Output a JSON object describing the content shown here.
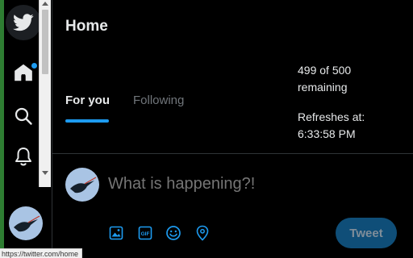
{
  "icons": {
    "logo": "twitter-bird-icon",
    "home": "home-icon",
    "search": "search-icon",
    "notifications": "bell-icon",
    "media": "image-icon",
    "gif": "gif-icon",
    "emoji": "emoji-icon",
    "location": "location-pin-icon"
  },
  "header": {
    "title": "Home"
  },
  "tabs": [
    {
      "label": "For you",
      "active": true
    },
    {
      "label": "Following",
      "active": false
    }
  ],
  "status": {
    "remaining_line1": "499 of 500",
    "remaining_line2": "remaining",
    "refresh_line1": "Refreshes at:",
    "refresh_line2": "6:33:58 PM"
  },
  "compose": {
    "placeholder": "What is happening?!",
    "tweet_label": "Tweet"
  },
  "gif_label": "GIF",
  "status_url": "https://twitter.com/home",
  "colors": {
    "accent": "#1d9bf0",
    "background": "#000000",
    "muted": "#71767b"
  }
}
